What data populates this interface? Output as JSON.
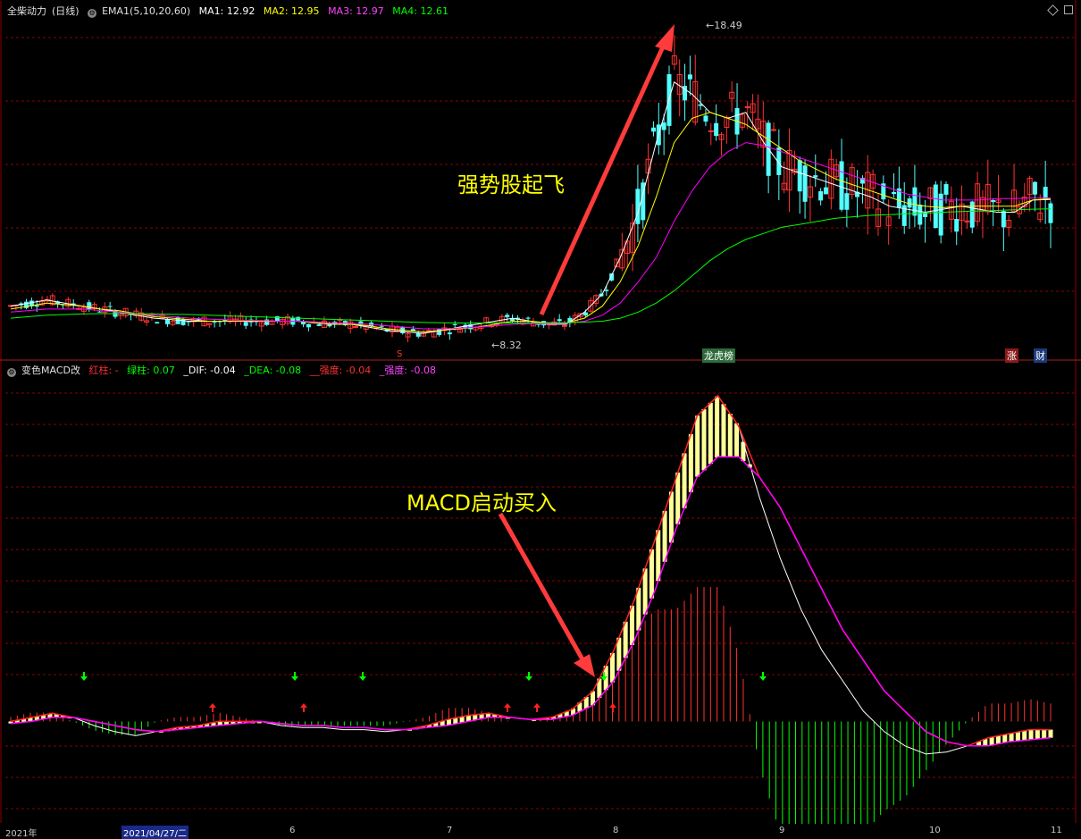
{
  "stock_header": {
    "name": "全柴动力",
    "period": "(日线)",
    "ema_label": "EMA1(5,10,20,60)",
    "ma1": "MA1: 12.92",
    "ma2": "MA2: 12.95",
    "ma3": "MA3: 12.97",
    "ma4": "MA4: 12.61"
  },
  "macd_header": {
    "name": "变色MACD改",
    "red_bar": "红柱: -",
    "green_bar": "绿柱: 0.07",
    "dif": "_DIF: -0.04",
    "dea": "_DEA: -0.08",
    "strength1": "__强度: -0.04",
    "strength2": "_强度: -0.08"
  },
  "annotations": {
    "top": "强势股起飞",
    "bottom": "MACD启动买入",
    "high_label": "18.49",
    "low_label": "8.32",
    "s_tag": "S",
    "longhu_tag": "龙虎榜",
    "zhang_tag": "涨",
    "cai_tag": "财"
  },
  "dates": {
    "d0": "2021年",
    "d1": "2021/04/27/二",
    "d2": "6",
    "d3": "7",
    "d4": "8",
    "d5": "9",
    "d6": "10",
    "d7": "11"
  },
  "colors": {
    "up": "#ff3232",
    "down": "#54ffff",
    "ma1": "#ffffff",
    "ma2": "#ffff00",
    "ma3": "#ff00ff",
    "ma4": "#00ff00",
    "grid": "#8b0000",
    "annotation": "#ffff00",
    "arrow": "#ff3b3b"
  },
  "chart_data": [
    {
      "type": "candlestick",
      "title": "全柴动力 (日线)",
      "series": [
        {
          "name": "MA1",
          "values": [
            9.4,
            9.5,
            9.6,
            9.5,
            9.4,
            9.3,
            9.2,
            9.1,
            9.0,
            8.95,
            8.9,
            8.9,
            8.9,
            8.9,
            8.9,
            8.9,
            8.9,
            8.85,
            8.8,
            8.8,
            8.7,
            8.6,
            8.55,
            8.5,
            8.6,
            8.7,
            8.8,
            8.9,
            9.0,
            8.9,
            8.8,
            8.8,
            9.2,
            9.8,
            11.0,
            12.5,
            14.8,
            16.8,
            16.4,
            15.8,
            15.6,
            15.8,
            14.8,
            14.0,
            13.8,
            13.6,
            13.4,
            13.2,
            13.0,
            12.7,
            12.6,
            12.5,
            12.6,
            12.7,
            12.6,
            12.5,
            12.5,
            12.9,
            12.92
          ]
        },
        {
          "name": "MA2",
          "values": [
            9.3,
            9.4,
            9.5,
            9.45,
            9.4,
            9.3,
            9.25,
            9.15,
            9.05,
            9.0,
            8.95,
            8.9,
            8.9,
            8.9,
            8.9,
            8.9,
            8.9,
            8.85,
            8.8,
            8.8,
            8.75,
            8.65,
            8.6,
            8.55,
            8.6,
            8.65,
            8.7,
            8.8,
            8.9,
            8.9,
            8.85,
            8.85,
            9.0,
            9.4,
            10.2,
            11.4,
            13.0,
            14.8,
            15.6,
            15.8,
            15.6,
            15.4,
            15.0,
            14.6,
            14.2,
            13.9,
            13.6,
            13.4,
            13.2,
            13.0,
            12.8,
            12.7,
            12.65,
            12.7,
            12.7,
            12.7,
            12.7,
            12.9,
            12.95
          ]
        },
        {
          "name": "MA3",
          "values": [
            9.2,
            9.25,
            9.3,
            9.3,
            9.3,
            9.25,
            9.2,
            9.15,
            9.1,
            9.05,
            9.0,
            8.97,
            8.95,
            8.93,
            8.92,
            8.9,
            8.9,
            8.88,
            8.85,
            8.83,
            8.8,
            8.75,
            8.7,
            8.65,
            8.65,
            8.67,
            8.7,
            8.75,
            8.8,
            8.82,
            8.82,
            8.83,
            8.9,
            9.1,
            9.5,
            10.2,
            11.0,
            12.2,
            13.2,
            14.0,
            14.5,
            14.8,
            14.7,
            14.5,
            14.3,
            14.1,
            13.9,
            13.7,
            13.5,
            13.3,
            13.1,
            13.0,
            12.9,
            12.9,
            12.9,
            12.95,
            12.95,
            12.97,
            12.97
          ]
        },
        {
          "name": "MA4",
          "values": [
            9.0,
            9.05,
            9.1,
            9.12,
            9.14,
            9.15,
            9.15,
            9.15,
            9.14,
            9.13,
            9.12,
            9.1,
            9.08,
            9.06,
            9.04,
            9.02,
            9.0,
            8.98,
            8.96,
            8.94,
            8.92,
            8.9,
            8.88,
            8.86,
            8.85,
            8.84,
            8.84,
            8.84,
            8.84,
            8.85,
            8.85,
            8.85,
            8.87,
            8.9,
            9.0,
            9.2,
            9.5,
            9.9,
            10.4,
            10.9,
            11.3,
            11.6,
            11.8,
            12.0,
            12.1,
            12.2,
            12.3,
            12.35,
            12.4,
            12.42,
            12.45,
            12.47,
            12.5,
            12.52,
            12.54,
            12.56,
            12.58,
            12.6,
            12.61
          ]
        }
      ],
      "high": 18.49,
      "low": 8.32
    },
    {
      "type": "bar",
      "title": "变色MACD改",
      "series": [
        {
          "name": "DIF",
          "values": [
            0.0,
            0.02,
            0.04,
            0.02,
            -0.02,
            -0.05,
            -0.07,
            -0.05,
            -0.03,
            -0.02,
            0.0,
            0.0,
            0.0,
            -0.02,
            -0.03,
            -0.03,
            -0.04,
            -0.04,
            -0.05,
            -0.04,
            -0.02,
            0.01,
            0.03,
            0.04,
            0.02,
            0.01,
            0.02,
            0.06,
            0.15,
            0.35,
            0.6,
            0.9,
            1.2,
            1.5,
            1.6,
            1.45,
            1.1,
            0.8,
            0.55,
            0.35,
            0.2,
            0.05,
            -0.05,
            -0.12,
            -0.16,
            -0.15,
            -0.12,
            -0.08,
            -0.06,
            -0.04,
            -0.04
          ]
        },
        {
          "name": "DEA",
          "values": [
            -0.01,
            0.0,
            0.02,
            0.02,
            0.0,
            -0.02,
            -0.04,
            -0.05,
            -0.04,
            -0.03,
            -0.02,
            -0.01,
            0.0,
            -0.01,
            -0.02,
            -0.02,
            -0.03,
            -0.03,
            -0.04,
            -0.04,
            -0.03,
            -0.02,
            0.0,
            0.02,
            0.02,
            0.01,
            0.01,
            0.03,
            0.08,
            0.2,
            0.4,
            0.65,
            0.95,
            1.2,
            1.3,
            1.3,
            1.2,
            1.05,
            0.85,
            0.65,
            0.45,
            0.3,
            0.15,
            0.05,
            -0.05,
            -0.1,
            -0.12,
            -0.12,
            -0.1,
            -0.09,
            -0.08
          ]
        }
      ]
    }
  ]
}
